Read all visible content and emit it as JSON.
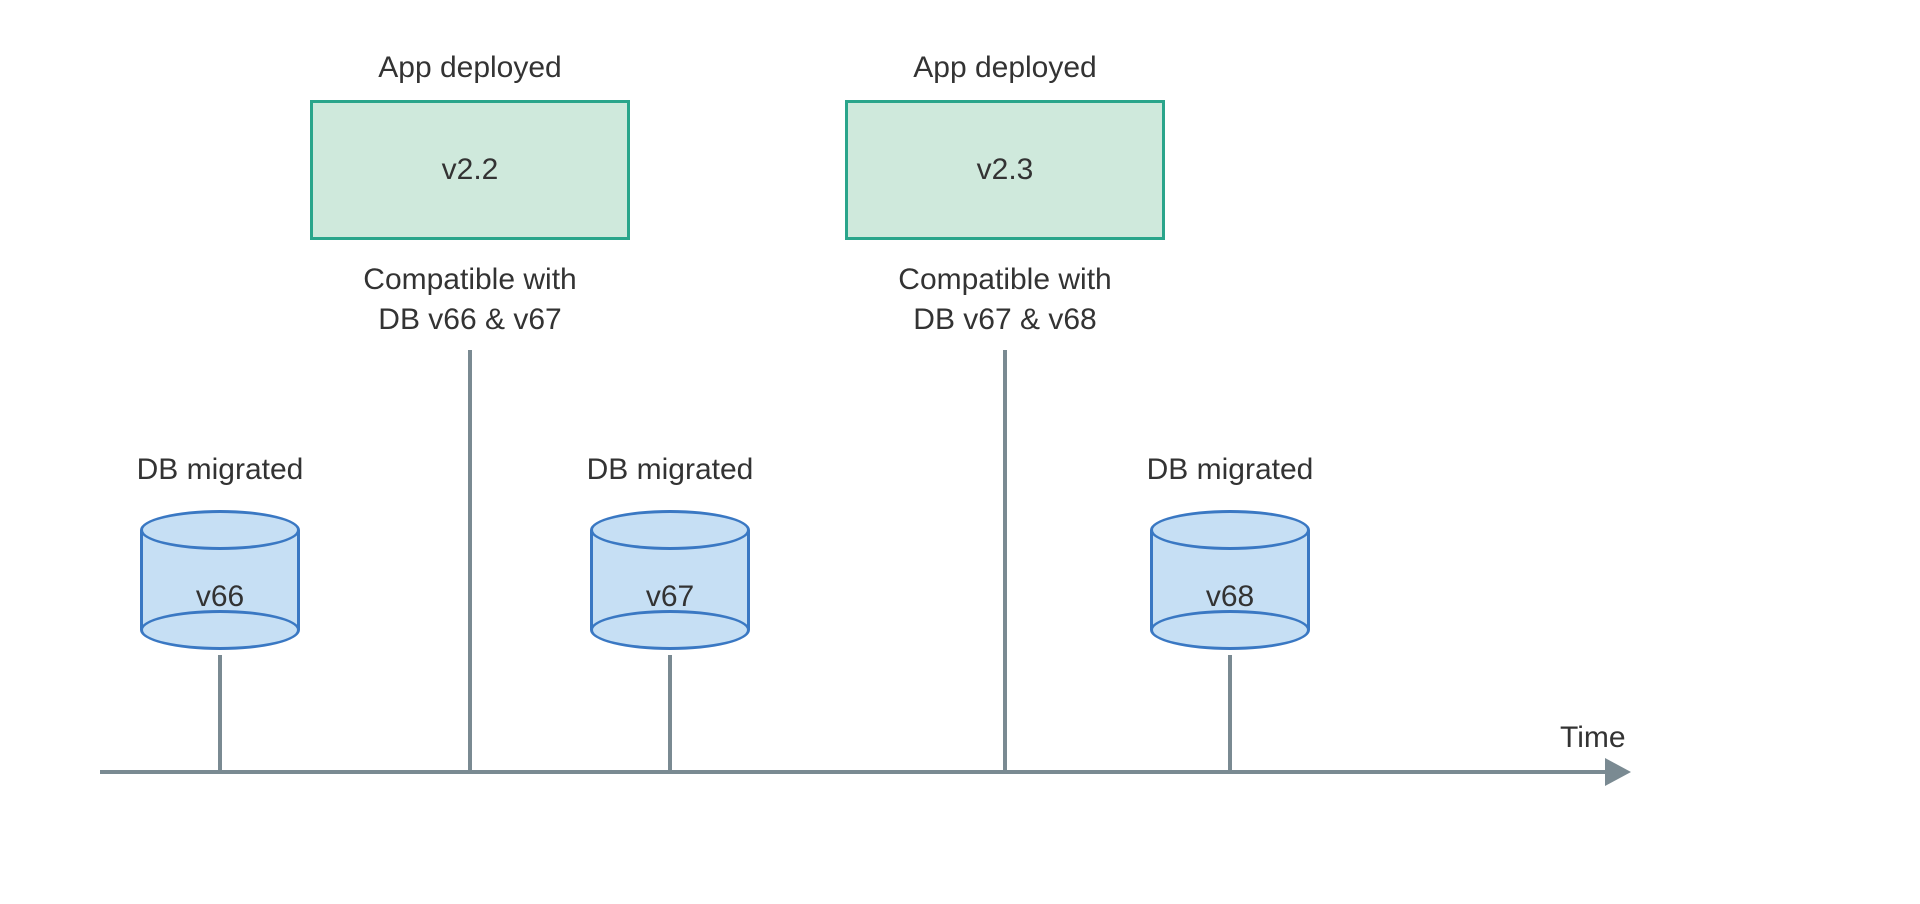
{
  "axis_label": "Time",
  "apps": [
    {
      "title": "App deployed",
      "version": "v2.2",
      "compat_line1": "Compatible with",
      "compat_line2": "DB  v66 & v67"
    },
    {
      "title": "App deployed",
      "version": "v2.3",
      "compat_line1": "Compatible with",
      "compat_line2": "DB  v67 & v68"
    }
  ],
  "dbs": [
    {
      "title": "DB migrated",
      "version": "v66"
    },
    {
      "title": "DB migrated",
      "version": "v67"
    },
    {
      "title": "DB migrated",
      "version": "v68"
    }
  ]
}
